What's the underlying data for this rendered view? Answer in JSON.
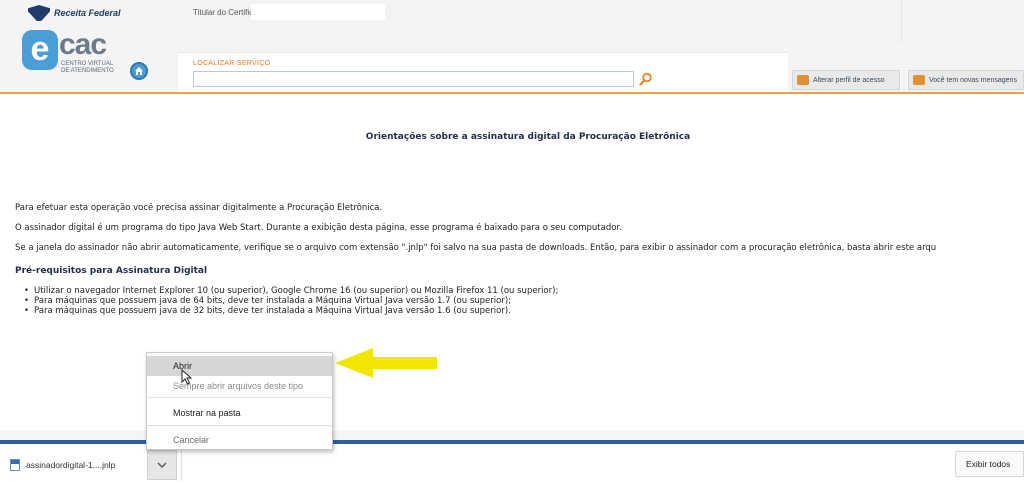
{
  "header": {
    "agency": "Receita Federal",
    "logo": {
      "e": "e",
      "cac": "cac",
      "subtitle": "CENTRO VIRTUAL DE ATENDIMENTO"
    },
    "certificate_label": "Titular do Certificado:",
    "certificate_value": "",
    "search_label": "LOCALIZAR SERVIÇO",
    "search_value": "",
    "change_profile_label": "Alterar perfil de acesso",
    "messages_label": "Você tem novas mensagens"
  },
  "content": {
    "title": "Orientações sobre a assinatura digital da Procuração Eletrônica",
    "paragraphs": [
      "Para efetuar esta operação você precisa assinar digitalmente a Procuração Eletrônica.",
      "O assinador digital é um programa do tipo Java Web Start. Durante a exibição desta página, esse programa é baixado para o seu computador.",
      "Se a janela do assinador não abrir automaticamente, verifique se o arquivo com extensão \".jnlp\" foi salvo na sua pasta de downloads. Então, para exibir o assinador com a procuração eletrônica, basta abrir este arqu"
    ],
    "prereq_title": "Pré-requisitos para Assinatura Digital",
    "prereq_items": [
      "Utilizar o navegador Internet Explorer 10 (ou superior), Google Chrome 16 (ou superior) ou Mozilla Firefox 11 (ou superior);",
      "Para máquinas que possuem java de 64 bits, deve ter instalada a Máquina Virtual Java versão 1.7 (ou superior);",
      "Para máquinas que possuem java de 32 bits, deve ter instalada a Máquina Virtual Java versão 1.6 (ou superior)."
    ]
  },
  "context_menu": {
    "open": "Abrir",
    "always_open": "Sempre abrir arquivos deste tipo",
    "show_in_folder": "Mostrar na pasta",
    "cancel": "Cancelar"
  },
  "download_bar": {
    "file_name": "assinadordigital-1....jnlp",
    "show_all": "Exibir todos"
  },
  "colors": {
    "accent_orange": "#f0a04b",
    "arrow_yellow": "#f2e600",
    "download_bar_blue": "#2a5e9a",
    "ecac_blue": "#4b9dd6"
  },
  "icons": [
    "receita-federal-emblem-icon",
    "home-icon",
    "search-icon",
    "user-profile-icon",
    "mail-icon",
    "jnlp-file-icon",
    "chevron-down-icon",
    "cursor-icon",
    "arrow-pointer-icon"
  ]
}
